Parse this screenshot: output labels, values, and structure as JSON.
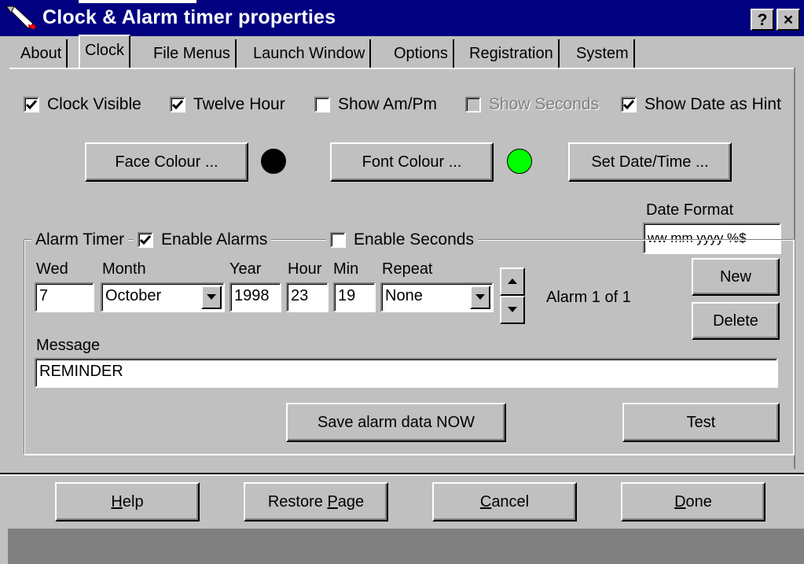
{
  "window": {
    "title": "Clock & Alarm timer properties",
    "help_button": "?",
    "close_button": "×"
  },
  "tabs": [
    {
      "label": "About"
    },
    {
      "label": "Clock",
      "active": true
    },
    {
      "label": "File Menus"
    },
    {
      "label": "Launch Window"
    },
    {
      "label": "Options"
    },
    {
      "label": "Registration"
    },
    {
      "label": "System"
    }
  ],
  "clock_options": {
    "clock_visible": {
      "label": "Clock Visible",
      "checked": true
    },
    "twelve_hour": {
      "label": "Twelve Hour",
      "checked": true
    },
    "show_ampm": {
      "label": "Show Am/Pm",
      "checked": false
    },
    "show_seconds": {
      "label": "Show Seconds",
      "checked": false,
      "disabled": true
    },
    "show_date_hint": {
      "label": "Show Date as Hint",
      "checked": true
    }
  },
  "colour_buttons": {
    "face_colour": "Face Colour ...",
    "face_colour_value": "#000000",
    "font_colour": "Font Colour ...",
    "font_colour_value": "#00ff00",
    "set_datetime": "Set Date/Time ..."
  },
  "date_format": {
    "label": "Date Format",
    "value": "ww mm yyyy %$"
  },
  "alarm": {
    "group_label": "Alarm Timer",
    "enable_alarms": {
      "label": "Enable Alarms",
      "checked": true
    },
    "enable_seconds": {
      "label": "Enable Seconds",
      "checked": false
    },
    "labels": {
      "wed": "Wed",
      "month": "Month",
      "year": "Year",
      "hour": "Hour",
      "min": "Min",
      "repeat": "Repeat",
      "message": "Message"
    },
    "values": {
      "wed": "7",
      "month": "October",
      "year": "1998",
      "hour": "23",
      "min": "19",
      "repeat": "None",
      "message": "REMINDER"
    },
    "counter": "Alarm 1 of 1",
    "new_button": "New",
    "delete_button": "Delete",
    "save_button": "Save alarm data NOW",
    "test_button": "Test"
  },
  "footer": {
    "help": {
      "pre": "",
      "key": "H",
      "post": "elp"
    },
    "restore": {
      "pre": "Restore ",
      "key": "P",
      "post": "age"
    },
    "cancel": {
      "pre": "",
      "key": "C",
      "post": "ancel"
    },
    "done": {
      "pre": "",
      "key": "D",
      "post": "one"
    }
  }
}
